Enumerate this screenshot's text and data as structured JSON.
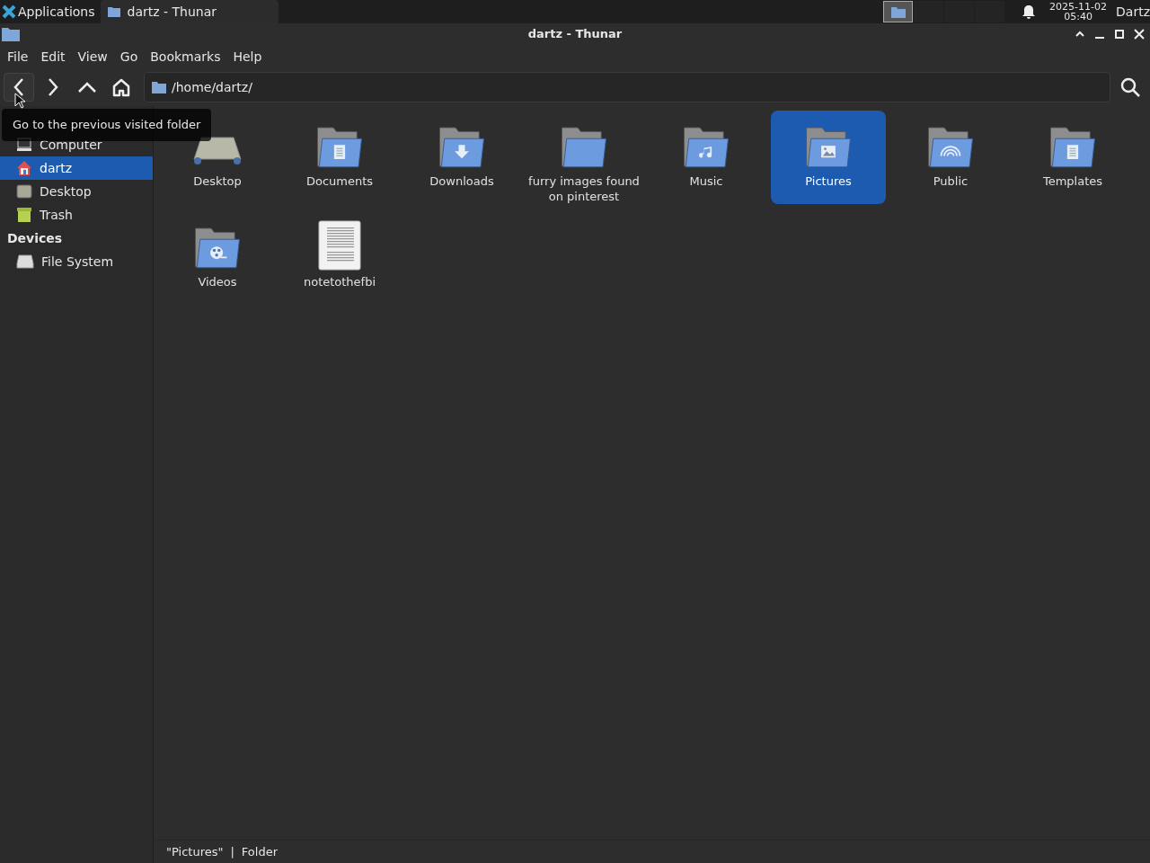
{
  "panel": {
    "apps_label": "Applications",
    "task": {
      "title": "dartz - Thunar",
      "selected": true
    },
    "clock_date": "2025-11-02",
    "clock_time": "05:40",
    "user": "Dartz"
  },
  "window": {
    "title": "dartz - Thunar"
  },
  "menu": [
    "File",
    "Edit",
    "View",
    "Go",
    "Bookmarks",
    "Help"
  ],
  "location": {
    "path": "/home/dartz/"
  },
  "tooltip": "Go to the previous visited folder",
  "sidebar": {
    "sections": [
      {
        "items": [
          {
            "label": "Computer",
            "kind": "computer",
            "selected": false
          },
          {
            "label": "dartz",
            "kind": "home",
            "selected": true
          },
          {
            "label": "Desktop",
            "kind": "desktop",
            "selected": false
          },
          {
            "label": "Trash",
            "kind": "trash",
            "selected": false
          }
        ]
      },
      {
        "title": "Devices",
        "items": [
          {
            "label": "File System",
            "kind": "drive",
            "selected": false
          }
        ]
      }
    ]
  },
  "files": [
    {
      "name": "Desktop",
      "kind": "desktop",
      "selected": false
    },
    {
      "name": "Documents",
      "kind": "documents",
      "selected": false
    },
    {
      "name": "Downloads",
      "kind": "downloads",
      "selected": false
    },
    {
      "name": "furry images found on pinterest",
      "kind": "folder",
      "selected": false
    },
    {
      "name": "Music",
      "kind": "music",
      "selected": false
    },
    {
      "name": "Pictures",
      "kind": "pictures",
      "selected": true
    },
    {
      "name": "Public",
      "kind": "public",
      "selected": false
    },
    {
      "name": "Templates",
      "kind": "templates",
      "selected": false
    },
    {
      "name": "Videos",
      "kind": "videos",
      "selected": false
    },
    {
      "name": "notetothefbi",
      "kind": "file",
      "selected": false
    }
  ],
  "status_bar": {
    "name": "\"Pictures\"",
    "separator": "|",
    "type": "Folder"
  }
}
